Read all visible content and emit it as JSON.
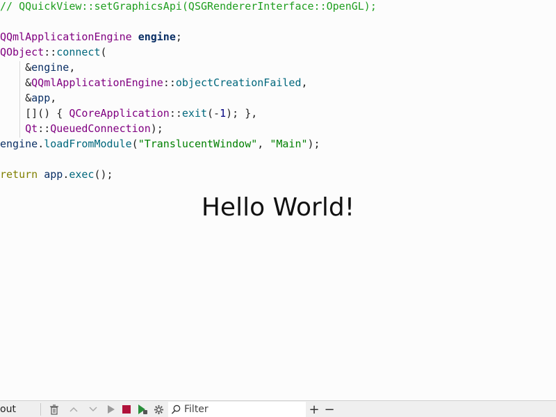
{
  "editor": {
    "lines": [
      [
        {
          "t": "// QQuickView::setGraphicsApi(QSGRendererInterface::OpenGL);",
          "c": "comment"
        }
      ],
      [],
      [
        {
          "t": "QQmlApplicationEngine",
          "c": "type"
        },
        {
          "t": " ",
          "c": "plain"
        },
        {
          "t": "engine",
          "c": "bold-ident"
        },
        {
          "t": ";",
          "c": "plain"
        }
      ],
      [
        {
          "t": "QObject",
          "c": "type"
        },
        {
          "t": "::",
          "c": "plain"
        },
        {
          "t": "connect",
          "c": "func"
        },
        {
          "t": "(",
          "c": "plain"
        }
      ],
      [
        {
          "t": "    &",
          "c": "plain"
        },
        {
          "t": "engine",
          "c": "ident"
        },
        {
          "t": ",",
          "c": "plain"
        }
      ],
      [
        {
          "t": "    &",
          "c": "plain"
        },
        {
          "t": "QQmlApplicationEngine",
          "c": "type"
        },
        {
          "t": "::",
          "c": "plain"
        },
        {
          "t": "objectCreationFailed",
          "c": "func"
        },
        {
          "t": ",",
          "c": "plain"
        }
      ],
      [
        {
          "t": "    &",
          "c": "plain"
        },
        {
          "t": "app",
          "c": "ident"
        },
        {
          "t": ",",
          "c": "plain"
        }
      ],
      [
        {
          "t": "    []() { ",
          "c": "plain"
        },
        {
          "t": "QCoreApplication",
          "c": "type"
        },
        {
          "t": "::",
          "c": "plain"
        },
        {
          "t": "exit",
          "c": "func"
        },
        {
          "t": "(-",
          "c": "plain"
        },
        {
          "t": "1",
          "c": "num"
        },
        {
          "t": "); },",
          "c": "plain"
        }
      ],
      [
        {
          "t": "    ",
          "c": "plain"
        },
        {
          "t": "Qt",
          "c": "type"
        },
        {
          "t": "::",
          "c": "plain"
        },
        {
          "t": "QueuedConnection",
          "c": "type"
        },
        {
          "t": ");",
          "c": "plain"
        }
      ],
      [
        {
          "t": "engine",
          "c": "ident"
        },
        {
          "t": ".",
          "c": "plain"
        },
        {
          "t": "loadFromModule",
          "c": "func"
        },
        {
          "t": "(",
          "c": "plain"
        },
        {
          "t": "\"TranslucentWindow\"",
          "c": "str"
        },
        {
          "t": ", ",
          "c": "plain"
        },
        {
          "t": "\"Main\"",
          "c": "str"
        },
        {
          "t": ");",
          "c": "plain"
        }
      ],
      [],
      [
        {
          "t": "return",
          "c": "kw"
        },
        {
          "t": " ",
          "c": "plain"
        },
        {
          "t": "app",
          "c": "ident"
        },
        {
          "t": ".",
          "c": "plain"
        },
        {
          "t": "exec",
          "c": "func"
        },
        {
          "t": "();",
          "c": "plain"
        }
      ]
    ]
  },
  "overlay": {
    "hello_text": "Hello World!"
  },
  "bottom_bar": {
    "pane_label": "out",
    "clear_icon": "trash-icon",
    "prev_icon": "chevron-up-icon",
    "next_icon": "chevron-down-icon",
    "run_icon": "play-icon",
    "stop_icon": "stop-icon",
    "debug_icon": "run-debug-icon",
    "settings_icon": "gear-icon",
    "filter_placeholder": "Filter",
    "zoom_in_label": "+",
    "zoom_out_label": "−",
    "colors": {
      "stop": "#b0123b",
      "run": "#2a8f3c"
    }
  }
}
